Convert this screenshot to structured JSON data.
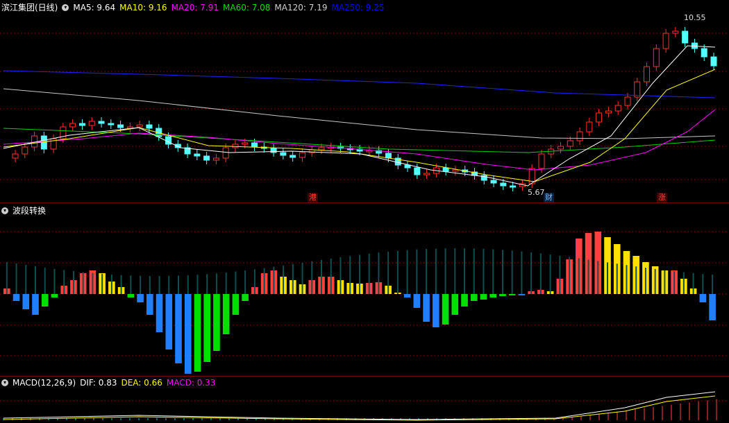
{
  "main": {
    "title": "滨江集团(日线)",
    "ma": [
      {
        "label": "MA5: 9.64",
        "color": "#ffffff"
      },
      {
        "label": "MA10: 9.16",
        "color": "#ffff00"
      },
      {
        "label": "MA20: 7.91",
        "color": "#ff00ff"
      },
      {
        "label": "MA60: 7.08",
        "color": "#00e000"
      },
      {
        "label": "MA120: 7.19",
        "color": "#d0d0d0"
      },
      {
        "label": "MA250: 9.25",
        "color": "#0000ff"
      }
    ],
    "high_label": "10.55",
    "low_label": "5.67",
    "markers": [
      {
        "text": "港",
        "color": "#ff4040",
        "bg": "#400000"
      },
      {
        "text": "财",
        "color": "#7fbfff",
        "bg": "#002040"
      },
      {
        "text": "涨",
        "color": "#ff4040",
        "bg": "#400000"
      }
    ]
  },
  "wave": {
    "title": "波段转换"
  },
  "macd": {
    "title": "MACD(12,26,9)",
    "dif": "DIF: 0.83",
    "dea": "DEA: 0.66",
    "macd": "MACD: 0.33",
    "dif_color": "#ffffff",
    "dea_color": "#ffff00",
    "macd_color": "#ff00ff"
  }
}
